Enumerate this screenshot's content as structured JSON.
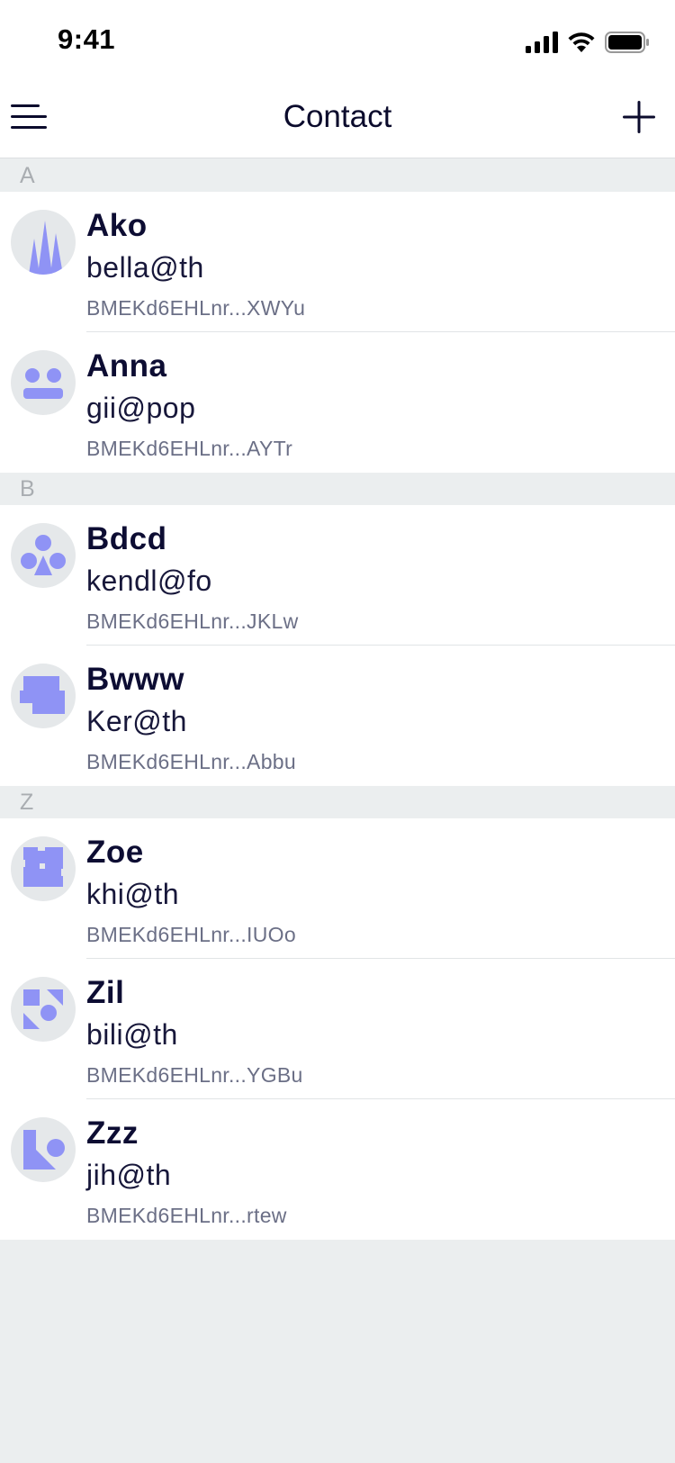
{
  "status_bar": {
    "time": "9:41"
  },
  "nav": {
    "title": "Contact"
  },
  "colors": {
    "accent": "#8f93f5",
    "avatar_bg": "#e5e8ea",
    "text_primary": "#0d0d33",
    "text_secondary": "#6b6f86",
    "section_bg": "#ebeeef"
  },
  "sections": [
    {
      "letter": "A",
      "contacts": [
        {
          "name": "Ako",
          "email": "bella@th",
          "address": "BMEKd6EHLnr...XWYu",
          "avatar_icon": "triangles-avatar-icon"
        },
        {
          "name": "Anna",
          "email": "gii@pop",
          "address": "BMEKd6EHLnr...AYTr",
          "avatar_icon": "face-avatar-icon"
        }
      ]
    },
    {
      "letter": "B",
      "contacts": [
        {
          "name": "Bdcd",
          "email": "kendl@fo",
          "address": "BMEKd6EHLnr...JKLw",
          "avatar_icon": "circles-triangle-avatar-icon"
        },
        {
          "name": "Bwww",
          "email": "Ker@th",
          "address": "BMEKd6EHLnr...Abbu",
          "avatar_icon": "blocks-avatar-icon"
        }
      ]
    },
    {
      "letter": "Z",
      "contacts": [
        {
          "name": "Zoe",
          "email": "khi@th",
          "address": "BMEKd6EHLnr...IUOo",
          "avatar_icon": "puzzle-avatar-icon"
        },
        {
          "name": "Zil",
          "email": "bili@th",
          "address": "BMEKd6EHLnr...YGBu",
          "avatar_icon": "shapes-avatar-icon"
        },
        {
          "name": "Zzz",
          "email": "jih@th",
          "address": "BMEKd6EHLnr...rtew",
          "avatar_icon": "square-circle-avatar-icon"
        }
      ]
    }
  ]
}
